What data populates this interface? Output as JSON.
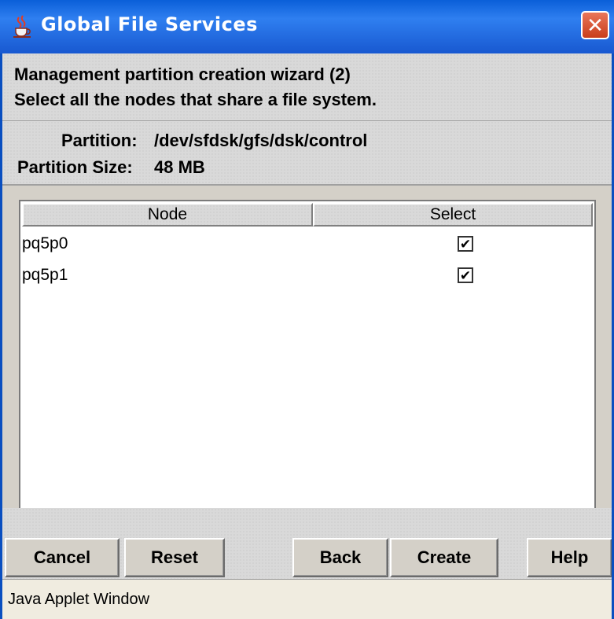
{
  "window": {
    "title": "Global File Services",
    "close_label": "✕"
  },
  "wizard": {
    "heading": "Management partition creation wizard (2)",
    "instruction": "Select all the nodes that share a file system."
  },
  "partition": {
    "partition_label": "Partition:",
    "partition_value": "/dev/sfdsk/gfs/dsk/control",
    "size_label": "Partition Size:",
    "size_value": "48 MB"
  },
  "table": {
    "columns": [
      "Node",
      "Select"
    ],
    "rows": [
      {
        "node": "pq5p0",
        "selected": true,
        "check_glyph": "✔"
      },
      {
        "node": "pq5p1",
        "selected": true,
        "check_glyph": "✔"
      }
    ]
  },
  "buttons": {
    "cancel": "Cancel",
    "reset": "Reset",
    "back": "Back",
    "create": "Create",
    "help": "Help"
  },
  "status": {
    "text": "Java Applet Window"
  },
  "icons": {
    "title": "java-cup-icon",
    "close": "close-icon",
    "checkbox": "checkmark-icon"
  },
  "colors": {
    "titlebar": "#1858d0",
    "close_button": "#c93d1a",
    "panel": "#d4d0c8",
    "status_bar": "#f0ece0"
  }
}
